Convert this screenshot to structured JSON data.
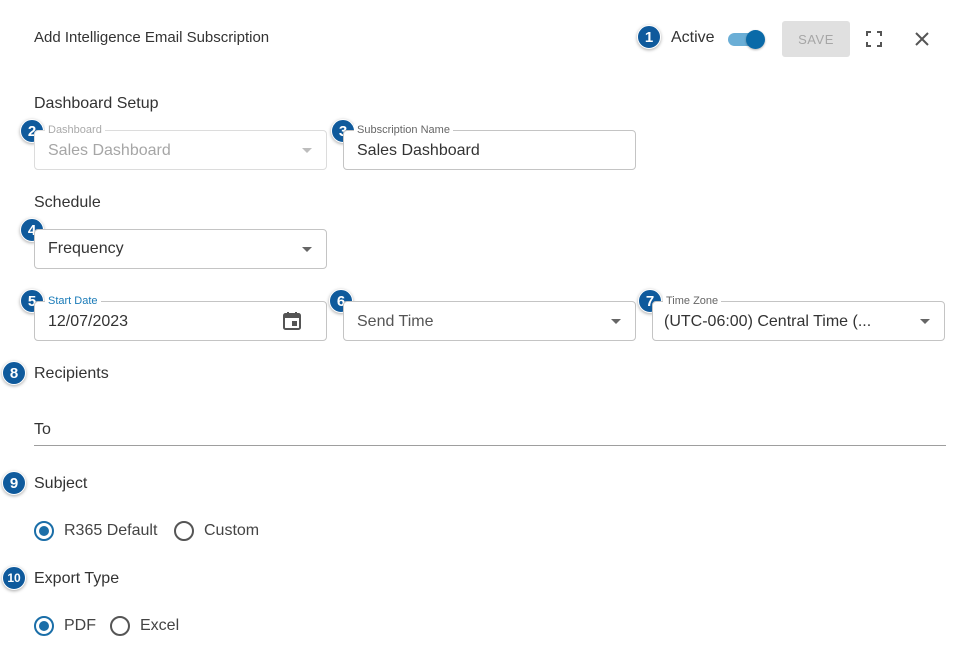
{
  "header": {
    "title": "Add Intelligence Email Subscription",
    "active_label": "Active",
    "active_on": true,
    "save_label": "SAVE"
  },
  "badges": [
    "1",
    "2",
    "3",
    "4",
    "5",
    "6",
    "7",
    "8",
    "9",
    "10"
  ],
  "dashboard_setup": {
    "section_title": "Dashboard Setup",
    "dashboard": {
      "label": "Dashboard",
      "value": "Sales Dashboard"
    },
    "subscription_name": {
      "label": "Subscription Name",
      "value": "Sales Dashboard"
    }
  },
  "schedule": {
    "section_title": "Schedule",
    "frequency": {
      "placeholder": "Frequency"
    },
    "start_date": {
      "label": "Start Date",
      "value": "12/07/2023"
    },
    "send_time": {
      "placeholder": "Send Time"
    },
    "time_zone": {
      "label": "Time Zone",
      "value": "(UTC-06:00) Central Time (..."
    }
  },
  "recipients": {
    "section_title": "Recipients",
    "to_label": "To"
  },
  "subject": {
    "section_title": "Subject",
    "options": [
      "R365 Default",
      "Custom"
    ],
    "selected": "R365 Default"
  },
  "export_type": {
    "section_title": "Export Type",
    "options": [
      "PDF",
      "Excel"
    ],
    "selected": "PDF"
  },
  "colors": {
    "accent": "#1a6ea8",
    "badge": "#0f5a9c",
    "toggle_track": "#6aaed6",
    "toggle_knob": "#0a6aa8"
  },
  "icons": [
    "fullscreen-icon",
    "close-icon",
    "calendar-icon",
    "dropdown-arrow-icon"
  ]
}
